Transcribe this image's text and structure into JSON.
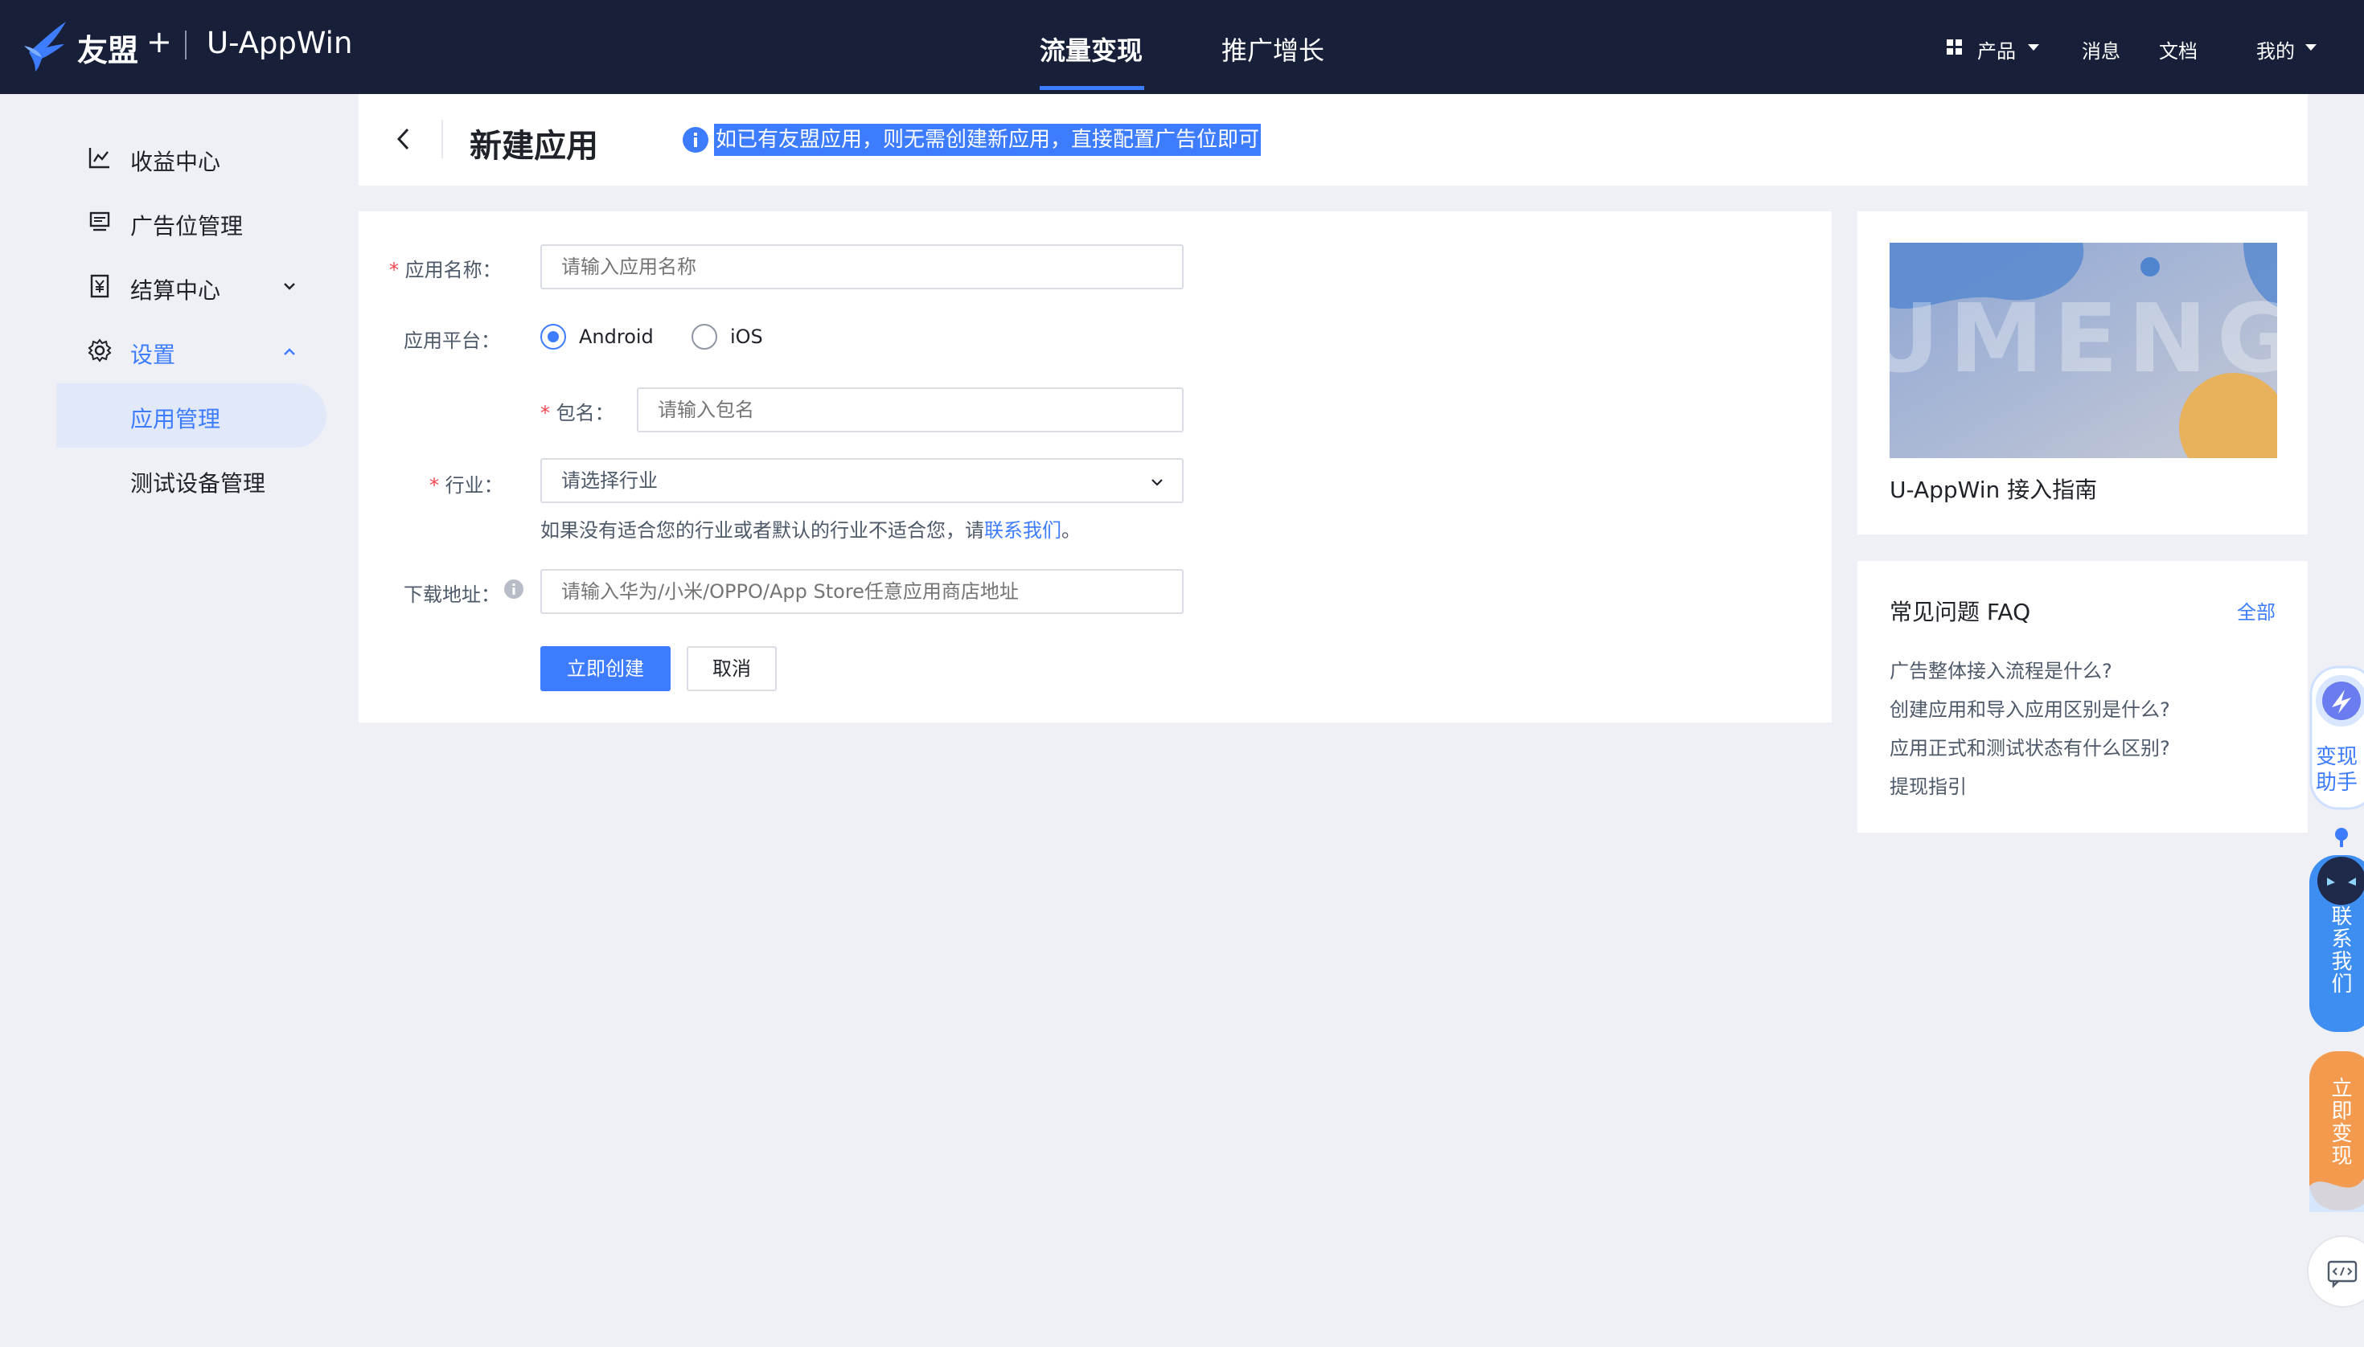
{
  "topbar": {
    "brand": "友盟",
    "plus": "+",
    "app_name": "U-AppWin",
    "tabs": [
      {
        "label": "流量变现",
        "active": true
      },
      {
        "label": "推广增长",
        "active": false
      }
    ],
    "right": {
      "products": "产品",
      "messages": "消息",
      "docs": "文档",
      "mine": "我的"
    }
  },
  "sidebar": {
    "items": [
      {
        "label": "收益中心",
        "icon": "chart-line-icon"
      },
      {
        "label": "广告位管理",
        "icon": "monitor-icon"
      },
      {
        "label": "结算中心",
        "icon": "yuan-receipt-icon",
        "expandable": true,
        "expanded": false
      },
      {
        "label": "设置",
        "icon": "gear-icon",
        "expandable": true,
        "expanded": true,
        "active": true
      }
    ],
    "sub_items": [
      {
        "label": "应用管理",
        "active": true
      },
      {
        "label": "测试设备管理",
        "active": false
      }
    ]
  },
  "header": {
    "title": "新建应用",
    "info": "如已有友盟应用，则无需创建新应用，直接配置广告位即可"
  },
  "form": {
    "app_name": {
      "required": "*",
      "label": "应用名称：",
      "placeholder": "请输入应用名称",
      "value": ""
    },
    "platform": {
      "label": "应用平台：",
      "options": [
        {
          "label": "Android",
          "checked": true
        },
        {
          "label": "iOS",
          "checked": false
        }
      ]
    },
    "package": {
      "required": "*",
      "label": "包名：",
      "placeholder": "请输入包名",
      "value": ""
    },
    "industry": {
      "required": "*",
      "label": "行业：",
      "placeholder": "请选择行业"
    },
    "industry_hint": {
      "text": "如果没有适合您的行业或者默认的行业不适合您，请",
      "link": "联系我们",
      "suffix": "。"
    },
    "download": {
      "label": "下载地址：",
      "placeholder": "请输入华为/小米/OPPO/App Store任意应用商店地址",
      "value": ""
    },
    "submit": "立即创建",
    "cancel": "取消"
  },
  "guide": {
    "banner_text": "UMENG",
    "title": "U-AppWin 接入指南"
  },
  "faq": {
    "title": "常见问题 FAQ",
    "all": "全部",
    "items": [
      "广告整体接入流程是什么?",
      "创建应用和导入应用区别是什么?",
      "应用正式和测试状态有什么区别?",
      "提现指引"
    ]
  },
  "floating": {
    "assistant": "变现助手",
    "contact": "联系我们",
    "monetize": "立即变现"
  },
  "colors": {
    "topbar_bg": "#172038",
    "accent": "#3d7cff",
    "page_bg": "#eef0f5",
    "required": "#f5464f",
    "orange_widget": "#f39a4e"
  }
}
